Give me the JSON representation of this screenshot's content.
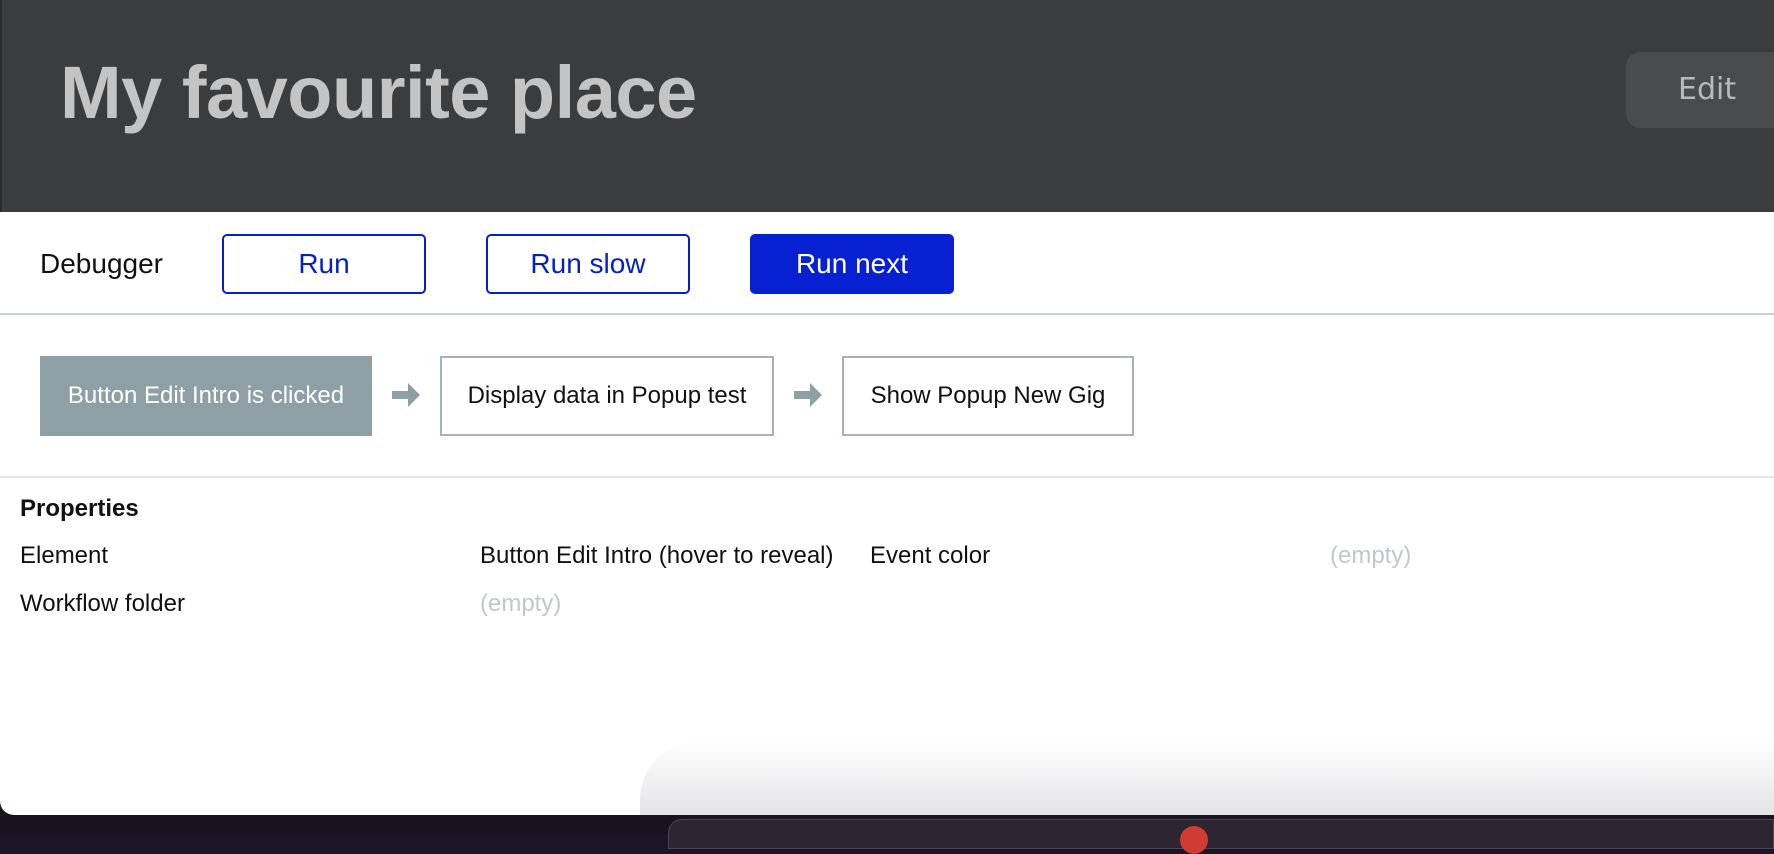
{
  "header": {
    "title": "My favourite place",
    "edit_label": "Edit"
  },
  "debugger": {
    "label": "Debugger",
    "buttons": [
      {
        "label": "Run",
        "style": "outline"
      },
      {
        "label": "Run slow",
        "style": "outline"
      },
      {
        "label": "Run next",
        "style": "primary"
      }
    ]
  },
  "workflow": {
    "steps": [
      {
        "label": "Button Edit Intro is clicked",
        "active": true
      },
      {
        "label": "Display data in Popup test",
        "active": false
      },
      {
        "label": "Show Popup New Gig",
        "active": false
      }
    ],
    "arrow_icon": "arrow-right-icon"
  },
  "properties": {
    "heading": "Properties",
    "rows": [
      {
        "key": "Element",
        "value": "Button Edit Intro (hover to reveal)"
      },
      {
        "key": "Event color",
        "value": "(empty)"
      },
      {
        "key": "Workflow folder",
        "value": "(empty)"
      }
    ]
  },
  "colors": {
    "header_bg": "#3b3c3e",
    "accent_blue": "#0620d2",
    "active_step": "#8e9fa6",
    "empty_text": "#c4c7ca"
  }
}
